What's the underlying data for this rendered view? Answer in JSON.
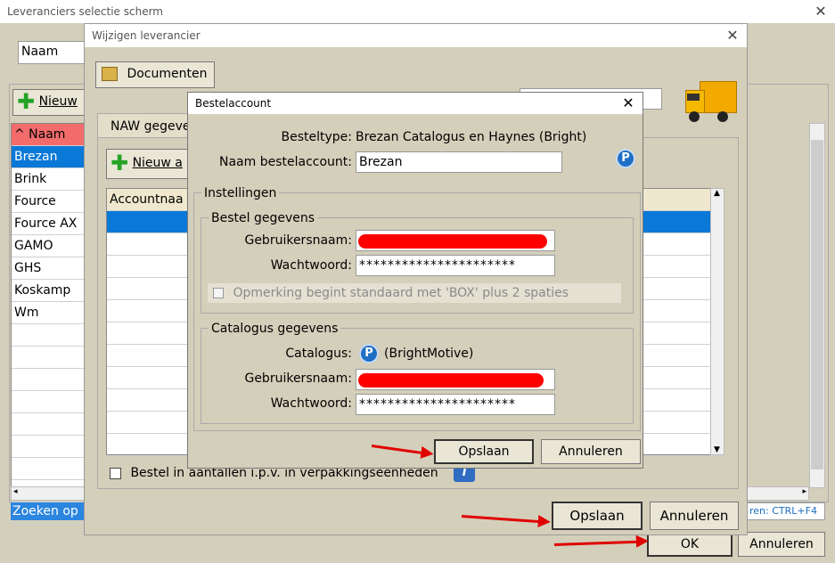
{
  "outer": {
    "title": "Leveranciers selectie scherm",
    "search_field": "Naam",
    "new_button": "Nieuw",
    "column_header": "^ Naam",
    "suppliers": [
      "Brezan",
      "Brink",
      "Fource",
      "Fource AX",
      "GAMO",
      "GHS",
      "Koskamp",
      "Wm"
    ],
    "search_label": "Zoeken op",
    "shortcut_hint": "ren: CTRL+F4",
    "ok": "OK",
    "cancel": "Annuleren"
  },
  "middle": {
    "title": "Wijzigen leverancier",
    "documents_button": "Documenten",
    "tab_label": "NAW gegeve",
    "new_button": "Nieuw a",
    "column_header": "Accountnaa",
    "checkbox_label": "Bestel in aantallen i.p.v. in verpakkingseenheden",
    "save": "Opslaan",
    "cancel": "Annuleren"
  },
  "dialog": {
    "title": "Bestelaccount",
    "ordertype_label": "Besteltype:",
    "ordertype_value": "Brezan Catalogus en Haynes (Bright)",
    "account_name_label": "Naam bestelaccount:",
    "account_name_value": "Brezan",
    "settings_group": "Instellingen",
    "order_group": "Bestel gegevens",
    "username_label": "Gebruikersnaam:",
    "password_label": "Wachtwoord:",
    "password_mask": "**********************",
    "remark_checkbox": "Opmerking begint standaard met 'BOX' plus 2 spaties",
    "catalog_group": "Catalogus gegevens",
    "catalog_label": "Catalogus:",
    "catalog_value": "(BrightMotive)",
    "catalog_username_label": "Gebruikersnaam:",
    "catalog_password_label": "Wachtwoord:",
    "catalog_password_mask": "**********************",
    "save": "Opslaan",
    "cancel": "Annuleren"
  },
  "icons": {
    "close": "close-icon",
    "folder": "folder-icon",
    "plus": "plus-icon",
    "truck": "truck-icon",
    "info": "info-icon",
    "brightmotive": "brightmotive-logo-icon"
  },
  "colors": {
    "selection": "#0a78d7",
    "header_red": "#f36b6b",
    "annotation_red": "#e00000",
    "window_bg": "#d4cfba"
  }
}
